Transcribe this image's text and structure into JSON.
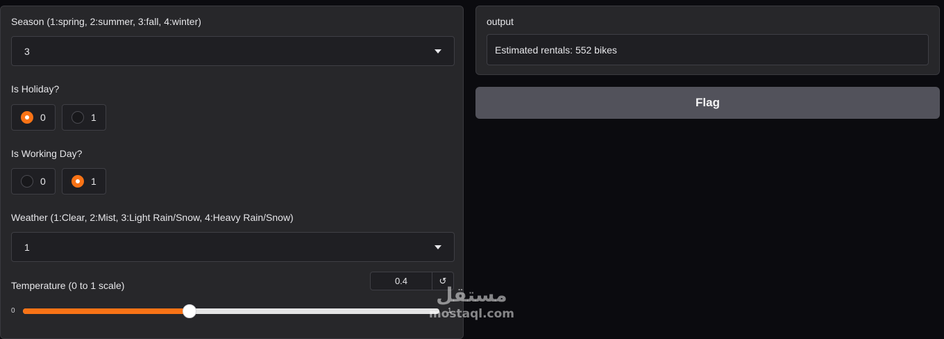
{
  "season": {
    "label": "Season (1:spring, 2:summer, 3:fall, 4:winter)",
    "value": "3"
  },
  "holiday": {
    "label": "Is Holiday?",
    "options": [
      "0",
      "1"
    ],
    "selected": 0
  },
  "working_day": {
    "label": "Is Working Day?",
    "options": [
      "0",
      "1"
    ],
    "selected": 1
  },
  "weather": {
    "label": "Weather (1:Clear, 2:Mist, 3:Light Rain/Snow, 4:Heavy Rain/Snow)",
    "value": "1"
  },
  "temperature": {
    "label": "Temperature (0 to 1 scale)",
    "value": "0.4",
    "value_fraction": 0.4,
    "min_label": "0",
    "max_label": "1",
    "reset_glyph": "↺"
  },
  "output": {
    "label": "output",
    "text": "Estimated rentals: 552 bikes"
  },
  "flag": {
    "label": "Flag"
  },
  "watermark": {
    "arabic": "مستقل",
    "latin": "mostaql.com"
  },
  "colors": {
    "accent": "#f97316",
    "panel": "#27272a",
    "background": "#0b0b0f",
    "button": "#52525b"
  },
  "icons": {
    "dropdown": "chevron-down-icon",
    "reset": "reset-icon"
  }
}
